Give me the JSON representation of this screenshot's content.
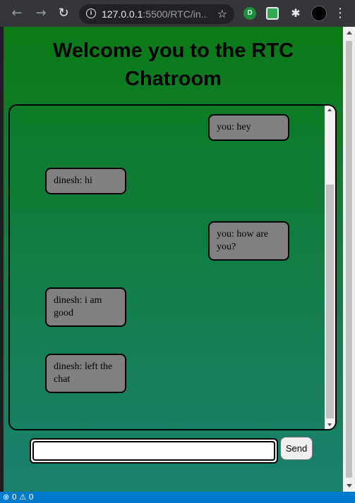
{
  "browser": {
    "url_host": "127.0.0.1",
    "url_rest": ":5500/RTC/in...",
    "back_glyph": "←",
    "forward_glyph": "→",
    "reload_glyph": "↻",
    "star_glyph": "☆",
    "menu_glyph": "⋮",
    "extensions_glyph": "✱",
    "ext1_letter": "D"
  },
  "page": {
    "title": "Welcome you to the RTC Chatroom"
  },
  "messages": [
    {
      "sender": "you",
      "text": "you: hey"
    },
    {
      "sender": "other",
      "text": "dinesh: hi"
    },
    {
      "sender": "you",
      "text": "you: how are you?"
    },
    {
      "sender": "other",
      "text": "dinesh: i am good"
    },
    {
      "sender": "other",
      "text": "dinesh: left the chat"
    }
  ],
  "composer": {
    "input_value": "",
    "send_label": "Send"
  },
  "statusbar": {
    "errors": "⊗ 0",
    "warnings": "⚠ 0"
  },
  "colors": {
    "gradient_top": "#0b7a16",
    "gradient_bottom": "#1a8170",
    "bubble": "#808080"
  }
}
